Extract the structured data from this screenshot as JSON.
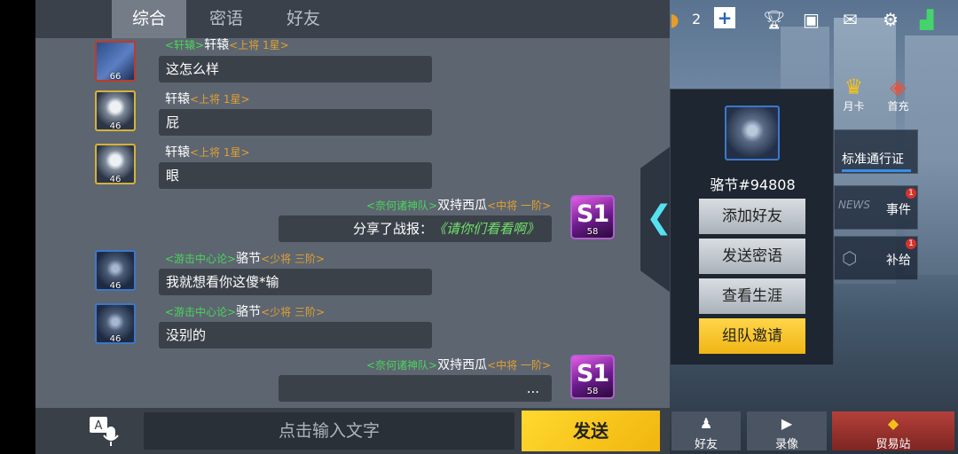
{
  "tabs": [
    {
      "label": "综合"
    },
    {
      "label": "密语"
    },
    {
      "label": "好友"
    }
  ],
  "messages": [
    {
      "name": "轩辕",
      "rank": "<上将 1星>",
      "guild": "<轩辕>",
      "text": "这怎么样",
      "level": "66"
    },
    {
      "name": "轩辕",
      "rank": "<上将 1星>",
      "text": "屁",
      "level": "46"
    },
    {
      "name": "轩辕",
      "rank": "<上将 1星>",
      "text": "眼",
      "level": "46"
    },
    {
      "guild": "<奈何诸神队>",
      "name": "双持西瓜",
      "rank": "<中将 一阶>",
      "text_prefix": "分享了战报：",
      "text_link": "《请你们看看啊》",
      "level": "58",
      "badge": "S1"
    },
    {
      "guild": "<游击中心论>",
      "name": "骆节",
      "rank": "<少将 三阶>",
      "text": "我就想看你这傻*输",
      "level": "46"
    },
    {
      "guild": "<游击中心论>",
      "name": "骆节",
      "rank": "<少将 三阶>",
      "text": "没别的",
      "level": "46"
    },
    {
      "guild": "<奈何诸神队>",
      "name": "双持西瓜",
      "rank": "<中将 一阶>",
      "text": "...",
      "level": "58",
      "badge": "S1"
    }
  ],
  "input": {
    "placeholder": "点击输入文字"
  },
  "send_label": "发送",
  "profile": {
    "name": "骆节#94808",
    "buttons": [
      "添加好友",
      "发送密语",
      "查看生涯",
      "组队邀请"
    ]
  },
  "topbar": {
    "count": "2"
  },
  "right_panel": {
    "monthly": "月卡",
    "first_charge": "首充",
    "pass": "标准通行证",
    "events": "事件",
    "events_badge": "1",
    "supply": "补给",
    "supply_badge": "1"
  },
  "bottom_nav": [
    "好友",
    "录像",
    "贸易站"
  ],
  "colors": {
    "accent_yellow": "#f5c518",
    "guild_green": "#49d65a",
    "rank_orange": "#e0a032",
    "link_green": "#6fe26a"
  }
}
